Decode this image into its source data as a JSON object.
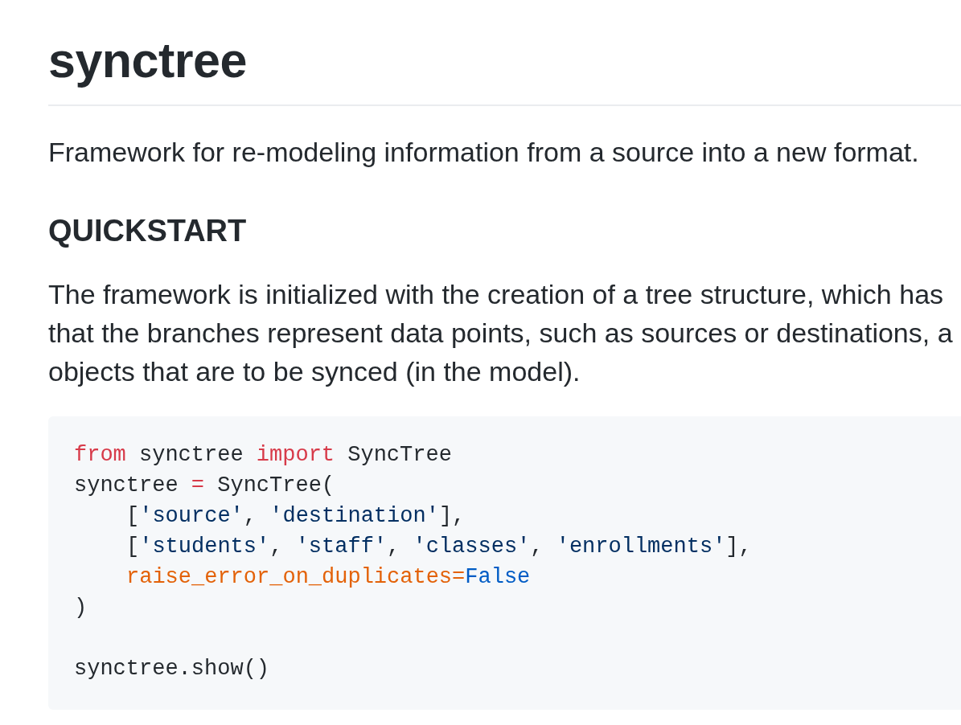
{
  "title": "synctree",
  "intro": "Framework for re-modeling information from a source into a new format.",
  "quickstart": {
    "heading": "QUICKSTART",
    "paragraph": {
      "lines": [
        "The framework is initialized with the creation of a tree structure, which has",
        "that the branches represent data points, such as sources or destinations, a",
        "objects that are to be synced (in the model)."
      ]
    },
    "code": {
      "blocks": [
        {
          "lines": [
            {
              "indented": false,
              "tokens": [
                {
                  "kind": "keyword",
                  "text": "from"
                },
                {
                  "kind": "plain",
                  "text": " synctree "
                },
                {
                  "kind": "keyword",
                  "text": "import"
                },
                {
                  "kind": "plain",
                  "text": " SyncTree"
                }
              ]
            },
            {
              "indented": false,
              "tokens": [
                {
                  "kind": "plain",
                  "text": "synctree "
                },
                {
                  "kind": "operator",
                  "text": "="
                },
                {
                  "kind": "plain",
                  "text": " SyncTree("
                }
              ]
            },
            {
              "indented": true,
              "tokens": [
                {
                  "kind": "plain",
                  "text": "["
                },
                {
                  "kind": "string",
                  "text": "'source'"
                },
                {
                  "kind": "plain",
                  "text": ", "
                },
                {
                  "kind": "string",
                  "text": "'destination'"
                },
                {
                  "kind": "plain",
                  "text": "],"
                }
              ]
            },
            {
              "indented": true,
              "tokens": [
                {
                  "kind": "plain",
                  "text": "["
                },
                {
                  "kind": "string",
                  "text": "'students'"
                },
                {
                  "kind": "plain",
                  "text": ", "
                },
                {
                  "kind": "string",
                  "text": "'staff'"
                },
                {
                  "kind": "plain",
                  "text": ", "
                },
                {
                  "kind": "string",
                  "text": "'classes'"
                },
                {
                  "kind": "plain",
                  "text": ", "
                },
                {
                  "kind": "string",
                  "text": "'enrollments'"
                },
                {
                  "kind": "plain",
                  "text": "],"
                }
              ]
            },
            {
              "indented": true,
              "tokens": [
                {
                  "kind": "param",
                  "text": "raise_error_on_duplicates="
                },
                {
                  "kind": "constant",
                  "text": "False"
                }
              ]
            },
            {
              "indented": false,
              "tokens": [
                {
                  "kind": "plain",
                  "text": ")"
                }
              ]
            }
          ]
        },
        {
          "lines": [
            {
              "indented": false,
              "tokens": [
                {
                  "kind": "plain",
                  "text": "synctree.show()"
                }
              ]
            }
          ]
        }
      ]
    }
  }
}
